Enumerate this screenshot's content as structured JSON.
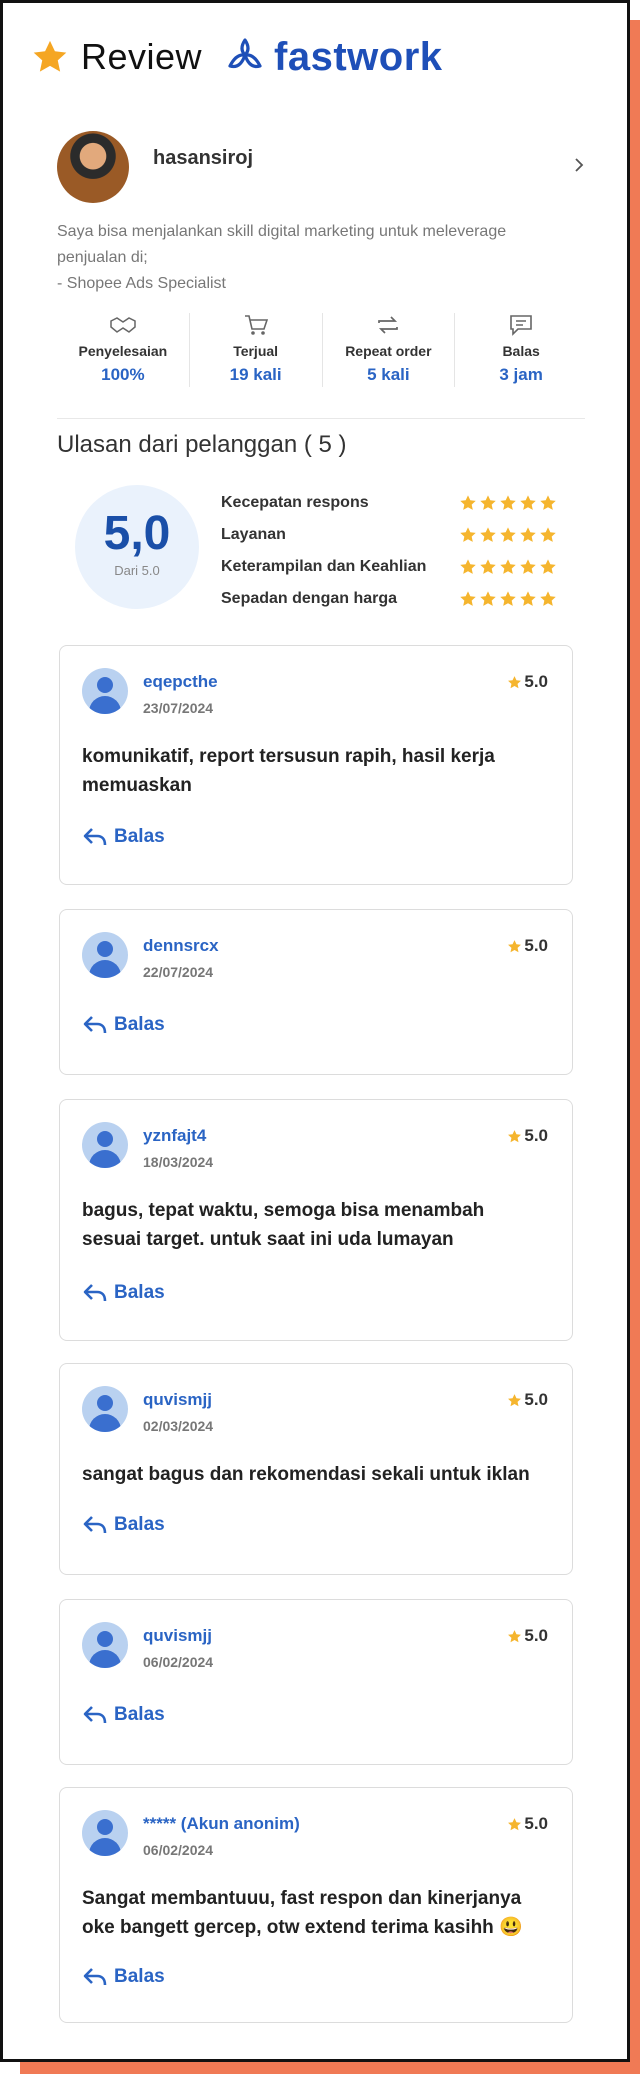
{
  "header": {
    "title": "Review",
    "brand": "fastwork",
    "brand_color": "#1e4fb8",
    "accent_color": "#f07a55"
  },
  "profile": {
    "username": "hasansiroj",
    "bio_line1": "Saya bisa menjalankan skill digital marketing untuk meleverage",
    "bio_line2": "penjualan di;",
    "bio_line3": "- Shopee Ads Specialist"
  },
  "stats": [
    {
      "icon": "handshake-icon",
      "label": "Penyelesaian",
      "value": "100%"
    },
    {
      "icon": "cart-icon",
      "label": "Terjual",
      "value": "19 kali"
    },
    {
      "icon": "repeat-icon",
      "label": "Repeat order",
      "value": "5 kali"
    },
    {
      "icon": "chat-icon",
      "label": "Balas",
      "value": "3 jam"
    }
  ],
  "ratings_section": {
    "title": "Ulasan dari pelanggan ( 5 )",
    "score": "5,0",
    "score_sub": "Dari 5.0",
    "criteria": [
      {
        "label": "Kecepatan respons",
        "stars": 5
      },
      {
        "label": "Layanan",
        "stars": 5
      },
      {
        "label": "Keterampilan dan Keahlian",
        "stars": 5
      },
      {
        "label": "Sepadan dengan harga",
        "stars": 5
      }
    ]
  },
  "reviews": [
    {
      "name": "eqepcthe",
      "date": "23/07/2024",
      "rating": "5.0",
      "text_line1": "komunikatif, report tersusun rapih, hasil kerja",
      "text_line2": "memuaskan",
      "reply": "Balas"
    },
    {
      "name": "dennsrcx",
      "date": "22/07/2024",
      "rating": "5.0",
      "text_line1": "",
      "text_line2": "",
      "reply": "Balas"
    },
    {
      "name": "yznfajt4",
      "date": "18/03/2024",
      "rating": "5.0",
      "text_line1": "bagus, tepat waktu, semoga bisa menambah",
      "text_line2": "sesuai target. untuk saat ini uda lumayan",
      "reply": "Balas"
    },
    {
      "name": "quvismjj",
      "date": "02/03/2024",
      "rating": "5.0",
      "text_line1": "sangat bagus dan rekomendasi sekali untuk iklan",
      "text_line2": "",
      "reply": "Balas"
    },
    {
      "name": "quvismjj",
      "date": "06/02/2024",
      "rating": "5.0",
      "text_line1": "",
      "text_line2": "",
      "reply": "Balas"
    },
    {
      "name": "***** (Akun anonim)",
      "date": "06/02/2024",
      "rating": "5.0",
      "text_line1": "Sangat membantuuu, fast respon dan kinerjanya",
      "text_line2": "oke bangett gercep, otw extend terima kasihh 😃",
      "reply": "Balas"
    }
  ],
  "star_color": "#f5b52e"
}
